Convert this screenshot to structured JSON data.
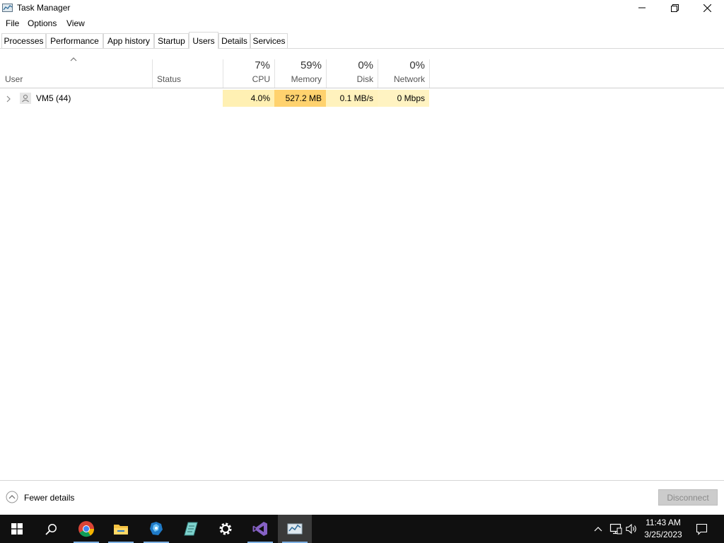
{
  "window": {
    "title": "Task Manager"
  },
  "menu": [
    "File",
    "Options",
    "View"
  ],
  "tabs": [
    {
      "label": "Processes",
      "active": false
    },
    {
      "label": "Performance",
      "active": false
    },
    {
      "label": "App history",
      "active": false
    },
    {
      "label": "Startup",
      "active": false
    },
    {
      "label": "Users",
      "active": true
    },
    {
      "label": "Details",
      "active": false
    },
    {
      "label": "Services",
      "active": false
    }
  ],
  "columns": {
    "user": {
      "label": "User"
    },
    "status": {
      "label": "Status"
    },
    "cpu": {
      "label": "CPU",
      "percent": "7%"
    },
    "memory": {
      "label": "Memory",
      "percent": "59%"
    },
    "disk": {
      "label": "Disk",
      "percent": "0%"
    },
    "network": {
      "label": "Network",
      "percent": "0%"
    }
  },
  "rows": [
    {
      "user": "VM5 (44)",
      "status": "",
      "cpu": "4.0%",
      "memory": "527.2 MB",
      "disk": "0.1 MB/s",
      "network": "0 Mbps"
    }
  ],
  "footer": {
    "fewer_details": "Fewer details",
    "disconnect": "Disconnect"
  },
  "taskbar": {
    "icons": [
      "windows-start-icon",
      "search-icon",
      "chrome-icon",
      "file-explorer-icon",
      "app-icon",
      "notepad-icon",
      "settings-icon",
      "visual-studio-icon",
      "task-manager-icon"
    ],
    "time": "11:43 AM",
    "date": "3/25/2023"
  },
  "colors": {
    "cpu_heat": "#fff0b3",
    "memory_heat": "#ffd26e",
    "disk_heat": "#fff2bd",
    "network_heat": "#fff3c2",
    "taskbar": "#101010"
  }
}
